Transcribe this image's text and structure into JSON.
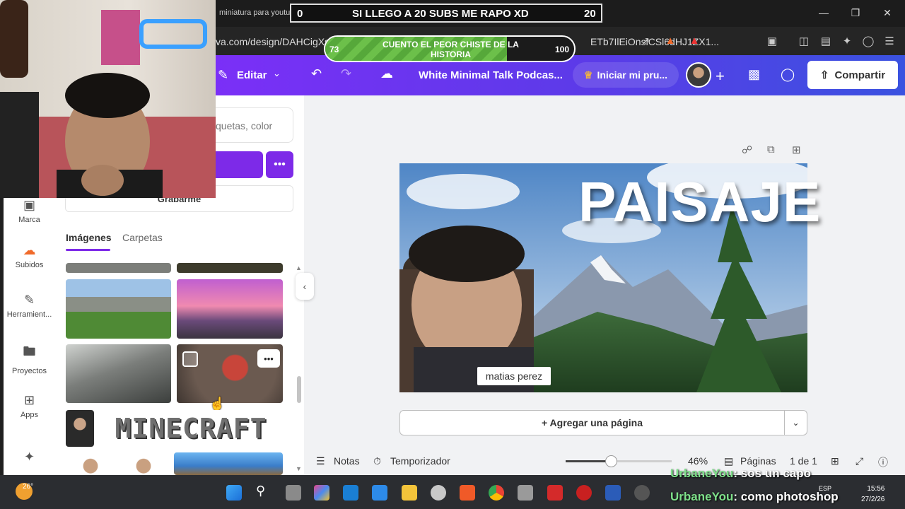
{
  "browser": {
    "tab_title": "miniatura para youtube - Canva",
    "url": "va.com/design/DAHCigXs",
    "url_tail": "ETb7IlEiOnsiCSl6dHJ1ZX1..."
  },
  "canva": {
    "edit_label": "Editar",
    "doc_title": "White Minimal Talk Podcas...",
    "trial_label": "Iniciar mi pru...",
    "share_label": "Compartir"
  },
  "left_rail": {
    "items": [
      {
        "label": "Marca",
        "icon": "brand-icon"
      },
      {
        "label": "Subidos",
        "icon": "upload-cloud-icon"
      },
      {
        "label": "Herramient...",
        "icon": "pen-tool-icon"
      },
      {
        "label": "Proyectos",
        "icon": "folder-icon"
      },
      {
        "label": "Apps",
        "icon": "apps-icon"
      }
    ]
  },
  "panel": {
    "search_placeholder": "quetas, color",
    "record_label": "Grabarme",
    "tab_images": "Imágenes",
    "tab_folders": "Carpetas",
    "thumb_menu": "•••",
    "minecraft_text": "MINECRAFT"
  },
  "design": {
    "title": "PAISAJE",
    "name_tag": "matias perez"
  },
  "canvas": {
    "add_page_label": "+ Agregar una página"
  },
  "bottom_bar": {
    "notes": "Notas",
    "timer": "Temporizador",
    "zoom": "46%",
    "zoom_fraction": 0.46,
    "pages": "Páginas",
    "page_count": "1 de 1"
  },
  "taskbar": {
    "weather": "26°",
    "lang": "ESP",
    "time": "15:56",
    "date": "27/2/26"
  },
  "stream": {
    "subs_current": "0",
    "subs_goal_text": "SI LLEGO A 20 SUBS ME RAPO XD",
    "subs_target": "20",
    "joke_current": "73",
    "joke_text": "CUENTO EL PEOR CHISTE DE LA HISTORIA",
    "joke_target": "100",
    "joke_fraction": 0.73,
    "chat": [
      {
        "user": "UrbaneYou",
        "message": ": sos un capo"
      },
      {
        "user": "UrbaneYou",
        "message": ": como photoshop"
      }
    ]
  },
  "colors": {
    "canva_purple": "#7d2ae8",
    "header_start": "#7b2ff7",
    "header_end": "#3a52e0",
    "progress_green": "#6cc04a",
    "chat_user": "#7ee08a"
  }
}
